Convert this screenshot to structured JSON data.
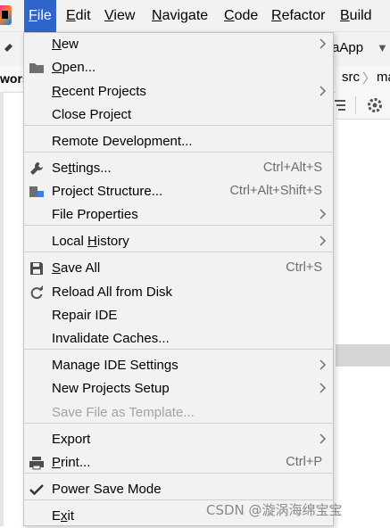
{
  "menubar": {
    "items": [
      {
        "label": "File",
        "mnemonic": "F"
      },
      {
        "label": "Edit",
        "mnemonic": "E"
      },
      {
        "label": "View",
        "mnemonic": "V"
      },
      {
        "label": "Navigate",
        "mnemonic": "N"
      },
      {
        "label": "Code",
        "mnemonic": "C"
      },
      {
        "label": "Refactor",
        "mnemonic": "R"
      },
      {
        "label": "Build",
        "mnemonic": "B"
      }
    ],
    "active": "File"
  },
  "background": {
    "run_config": "aApp",
    "breadcrumb": [
      "src",
      "ma"
    ],
    "project_tab": "wors"
  },
  "file_menu": {
    "groups": [
      [
        {
          "label": "New",
          "mnemonic": "N",
          "submenu": true
        },
        {
          "label": "Open...",
          "mnemonic": "O",
          "icon": "folder-icon"
        },
        {
          "label": "Recent Projects",
          "mnemonic": "R",
          "submenu": true
        },
        {
          "label": "Close Project"
        }
      ],
      [
        {
          "label": "Remote Development..."
        }
      ],
      [
        {
          "label": "Settings...",
          "mnemonic": "t",
          "icon": "wrench-icon",
          "shortcut": "Ctrl+Alt+S"
        },
        {
          "label": "Project Structure...",
          "icon": "project-structure-icon",
          "shortcut": "Ctrl+Alt+Shift+S"
        },
        {
          "label": "File Properties",
          "submenu": true
        }
      ],
      [
        {
          "label": "Local History",
          "mnemonic": "H",
          "submenu": true
        }
      ],
      [
        {
          "label": "Save All",
          "mnemonic": "S",
          "icon": "save-icon",
          "shortcut": "Ctrl+S"
        },
        {
          "label": "Reload All from Disk",
          "icon": "reload-icon"
        },
        {
          "label": "Repair IDE"
        },
        {
          "label": "Invalidate Caches..."
        }
      ],
      [
        {
          "label": "Manage IDE Settings",
          "submenu": true
        },
        {
          "label": "New Projects Setup",
          "submenu": true
        },
        {
          "label": "Save File as Template...",
          "disabled": true
        }
      ],
      [
        {
          "label": "Export",
          "submenu": true
        },
        {
          "label": "Print...",
          "mnemonic": "P",
          "icon": "print-icon",
          "shortcut": "Ctrl+P"
        }
      ],
      [
        {
          "label": "Power Save Mode",
          "icon": "checkmark-icon",
          "checked": true
        }
      ],
      [
        {
          "label": "Exit",
          "mnemonic": "x"
        }
      ]
    ]
  },
  "watermark": "CSDN @漩涡海绵宝宝",
  "colors": {
    "menu_active": "#2f65ca",
    "menu_background": "#f2f2f2",
    "shortcut_text": "#6d6d6d",
    "disabled_text": "#a3a3a3"
  }
}
